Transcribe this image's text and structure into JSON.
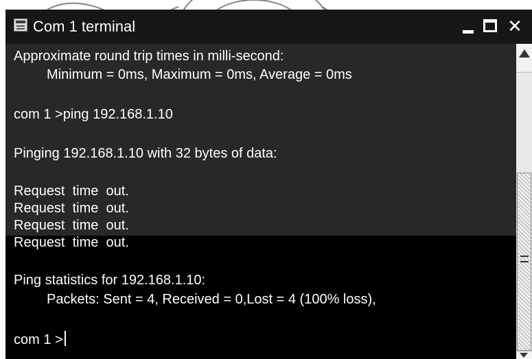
{
  "window": {
    "title": "Com 1 terminal",
    "title_icon": "terminal-icon",
    "controls": {
      "minimize_icon": "minimize-icon",
      "maximize_icon": "maximize-icon",
      "close_icon": "close-icon",
      "close_glyph": "✕"
    }
  },
  "console": {
    "lines": [
      "Approximate round trip times in milli-second:",
      "Minimum = 0ms, Maximum = 0ms, Average = 0ms",
      "com 1 >ping 192.168.1.10",
      "Pinging 192.168.1.10 with 32 bytes of data:",
      "Request  time  out.",
      "Request  time  out.",
      "Request  time  out.",
      "Request  time  out.",
      "Ping statistics for 192.168.1.10:",
      "Packets: Sent = 4, Received = 0,Lost = 4 (100% loss),",
      "com 1 >"
    ]
  },
  "scrollbar": {
    "up_icon": "scroll-up-icon",
    "down_icon": "scroll-down-icon"
  },
  "colors": {
    "terminal_bg": "#000000",
    "terminal_bg_upper": "#282828",
    "text": "#ffffff",
    "watermark": "#5a5a5a"
  }
}
